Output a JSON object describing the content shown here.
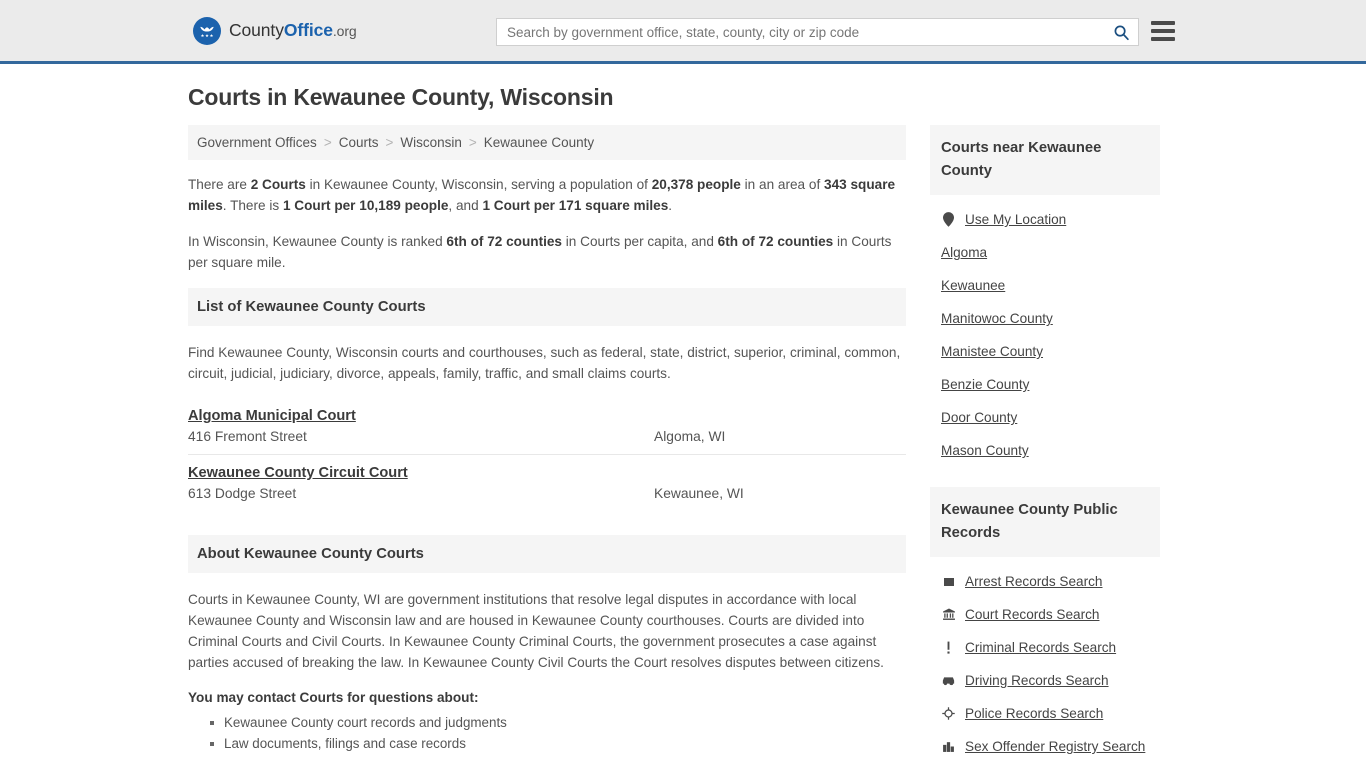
{
  "header": {
    "logo": {
      "part1": "County",
      "part2": "Office",
      "part3": ".org"
    },
    "search": {
      "placeholder": "Search by government office, state, county, city or zip code",
      "value": "",
      "icon": "search-icon"
    },
    "menu_icon": "hamburger-menu-icon"
  },
  "page": {
    "title": "Courts in Kewaunee County, Wisconsin"
  },
  "breadcrumb": {
    "separator": ">",
    "items": [
      {
        "label": "Government Offices"
      },
      {
        "label": "Courts"
      },
      {
        "label": "Wisconsin"
      },
      {
        "label": "Kewaunee County"
      }
    ]
  },
  "intro": {
    "p1": {
      "s1": "There are ",
      "b1": "2 Courts",
      "s2": " in Kewaunee County, Wisconsin, serving a population of ",
      "b2": "20,378 people",
      "s3": " in an area of ",
      "b3": "343 square miles",
      "s4": ". There is ",
      "b4": "1 Court per 10,189 people",
      "s5": ", and ",
      "b5": "1 Court per 171 square miles",
      "s6": "."
    },
    "p2": {
      "s1": "In Wisconsin, Kewaunee County is ranked ",
      "b1": "6th of 72 counties",
      "s2": " in Courts per capita, and ",
      "b2": "6th of 72 counties",
      "s3": " in Courts per square mile."
    }
  },
  "list_section": {
    "heading": "List of Kewaunee County Courts",
    "description": "Find Kewaunee County, Wisconsin courts and courthouses, such as federal, state, district, superior, criminal, common, circuit, judicial, judiciary, divorce, appeals, family, traffic, and small claims courts.",
    "courts": [
      {
        "name": "Algoma Municipal Court",
        "address": "416 Fremont Street",
        "city": "Algoma, WI"
      },
      {
        "name": "Kewaunee County Circuit Court",
        "address": "613 Dodge Street",
        "city": "Kewaunee, WI"
      }
    ]
  },
  "about_section": {
    "heading": "About Kewaunee County Courts",
    "paragraph": "Courts in Kewaunee County, WI are government institutions that resolve legal disputes in accordance with local Kewaunee County and Wisconsin law and are housed in Kewaunee County courthouses. Courts are divided into Criminal Courts and Civil Courts. In Kewaunee County Criminal Courts, the government prosecutes a case against parties accused of breaking the law. In Kewaunee County Civil Courts the Court resolves disputes between citizens.",
    "contact_lead": "You may contact Courts for questions about:",
    "contact_items": [
      "Kewaunee County court records and judgments",
      "Law documents, filings and case records"
    ]
  },
  "sidebar": {
    "nearby": {
      "heading": "Courts near Kewaunee County",
      "items": [
        {
          "label": "Use My Location",
          "icon": "map-pin-icon"
        },
        {
          "label": "Algoma",
          "icon": ""
        },
        {
          "label": "Kewaunee",
          "icon": ""
        },
        {
          "label": "Manitowoc County",
          "icon": ""
        },
        {
          "label": "Manistee County",
          "icon": ""
        },
        {
          "label": "Benzie County",
          "icon": ""
        },
        {
          "label": "Door County",
          "icon": ""
        },
        {
          "label": "Mason County",
          "icon": ""
        }
      ]
    },
    "public_records": {
      "heading": "Kewaunee County Public Records",
      "items": [
        {
          "label": "Arrest Records Search",
          "icon": "handcuffs-icon"
        },
        {
          "label": "Court Records Search",
          "icon": "courthouse-icon"
        },
        {
          "label": "Criminal Records Search",
          "icon": "exclamation-icon"
        },
        {
          "label": "Driving Records Search",
          "icon": "car-icon"
        },
        {
          "label": "Police Records Search",
          "icon": "police-badge-icon"
        },
        {
          "label": "Sex Offender Registry Search",
          "icon": "buildings-icon"
        }
      ]
    }
  },
  "colors": {
    "header_bg": "#ebebeb",
    "header_border": "#33689c",
    "brand_blue": "#1b62ad",
    "section_bg": "#f5f5f5",
    "body_text": "#555555",
    "heading_text": "#3b3b3b"
  }
}
